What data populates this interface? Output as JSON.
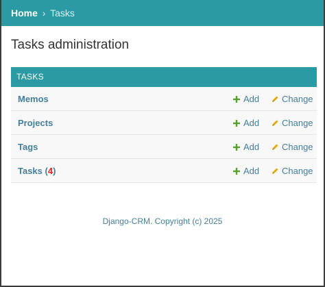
{
  "breadcrumbs": {
    "home": "Home",
    "separator": "›",
    "current": "Tasks"
  },
  "page": {
    "title": "Tasks administration"
  },
  "module": {
    "caption": "TASKS",
    "rows": [
      {
        "name": "Memos",
        "count_prefix": "",
        "count": "",
        "count_suffix": "",
        "add_label": "Add",
        "change_label": "Change"
      },
      {
        "name": "Projects",
        "count_prefix": "",
        "count": "",
        "count_suffix": "",
        "add_label": "Add",
        "change_label": "Change"
      },
      {
        "name": "Tags",
        "count_prefix": "",
        "count": "",
        "count_suffix": "",
        "add_label": "Add",
        "change_label": "Change"
      },
      {
        "name": "Tasks",
        "count_prefix": " (",
        "count": "4",
        "count_suffix": ")",
        "add_label": "Add",
        "change_label": "Change"
      }
    ]
  },
  "footer": {
    "text": "Django-CRM. Copyright (c) 2025"
  },
  "icons": {
    "add": "plus-icon",
    "change": "pencil-icon"
  },
  "colors": {
    "header_bg": "#2b9aa4",
    "link": "#447e9b",
    "add_icon": "#5aa02c",
    "change_icon": "#e0a800",
    "count": "#e41e1e"
  }
}
